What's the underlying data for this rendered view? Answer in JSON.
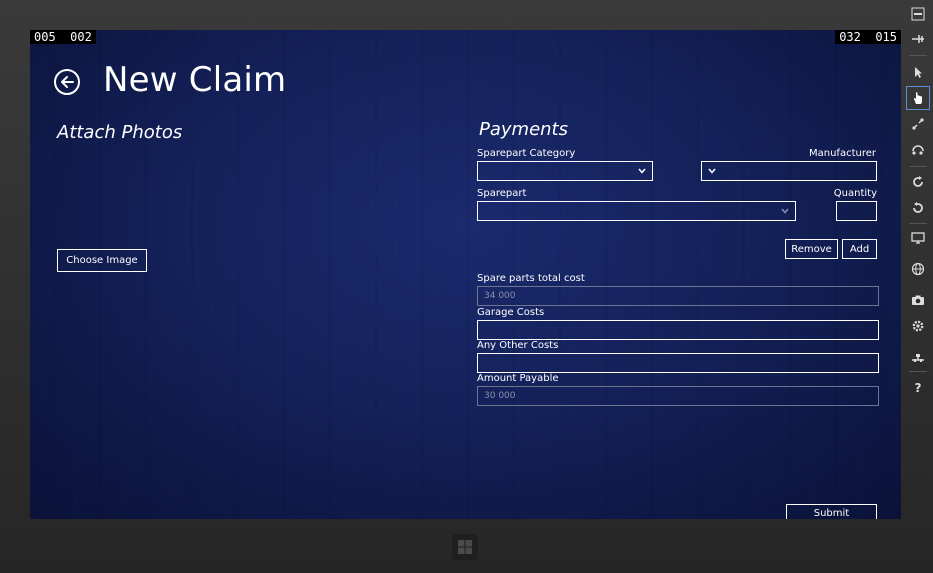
{
  "fps": {
    "left": "005  002",
    "right": "032  015"
  },
  "header": {
    "title": "New Claim"
  },
  "photos": {
    "heading": "Attach Photos",
    "choose_button": "Choose Image"
  },
  "payments": {
    "heading": "Payments",
    "sparepart_category_label": "Sparepart Category",
    "manufacturer_label": "Manufacturer",
    "sparepart_label": "Sparepart",
    "quantity_label": "Quantity",
    "remove_button": "Remove",
    "add_button": "Add",
    "spare_total_label": "Spare parts total cost",
    "spare_total_value": "34 000",
    "garage_costs_label": "Garage Costs",
    "other_costs_label": "Any Other Costs",
    "amount_payable_label": "Amount Payable",
    "amount_payable_value": "30 000",
    "submit_button": "Submit"
  },
  "appbar": {
    "icons": [
      "minimize-icon",
      "pin-icon",
      "pointer-icon",
      "touch-icon",
      "pinch-zoom-icon",
      "rotate-touch-icon",
      "rotate-clockwise-icon",
      "rotate-counterclockwise-icon",
      "resolution-icon",
      "location-icon",
      "screenshot-icon",
      "settings-icon",
      "network-icon",
      "help-icon"
    ],
    "help_glyph": "?"
  },
  "colors": {
    "background_navy": "#14215a",
    "accent_blue": "#5a8fd6"
  }
}
